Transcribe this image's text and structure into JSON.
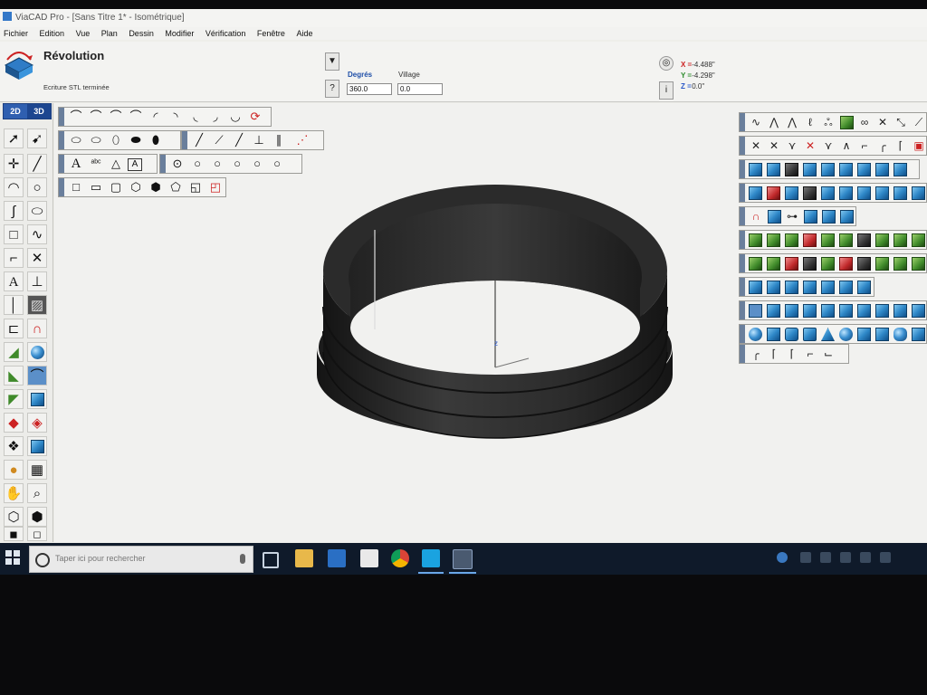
{
  "window": {
    "title": "ViaCAD Pro - [Sans Titre 1* - Isométrique]"
  },
  "menu": {
    "items": [
      "Fichier",
      "Edition",
      "Vue",
      "Plan",
      "Dessin",
      "Modifier",
      "Vérification",
      "Fenêtre",
      "Aide"
    ]
  },
  "command": {
    "name": "Révolution",
    "status": "Ecriture STL terminée",
    "info_button": "?",
    "dropdown_button": "▼",
    "help_button": "i",
    "options_button": "◎"
  },
  "fields": {
    "degrees_label": "Degrés",
    "degrees_value": "360.0",
    "village_label": "Village",
    "village_value": "0.0"
  },
  "coordinates": {
    "x_label": "X =",
    "x_value": "-4.488\"",
    "y_label": "Y =",
    "y_value": "-4.298\"",
    "z_label": "Z =",
    "z_value": "0.0\""
  },
  "mode_tabs": {
    "tab_2d": "2D",
    "tab_3d": "3D"
  },
  "viewport": {
    "axis_label": "z"
  },
  "taskbar": {
    "search_placeholder": "Taper ici pour rechercher"
  },
  "colors": {
    "accent": "#2f5fb0",
    "solid": "#2a2a2a",
    "viewport_bg": "#f1f1ef",
    "taskbar": "#0f1a2a"
  }
}
